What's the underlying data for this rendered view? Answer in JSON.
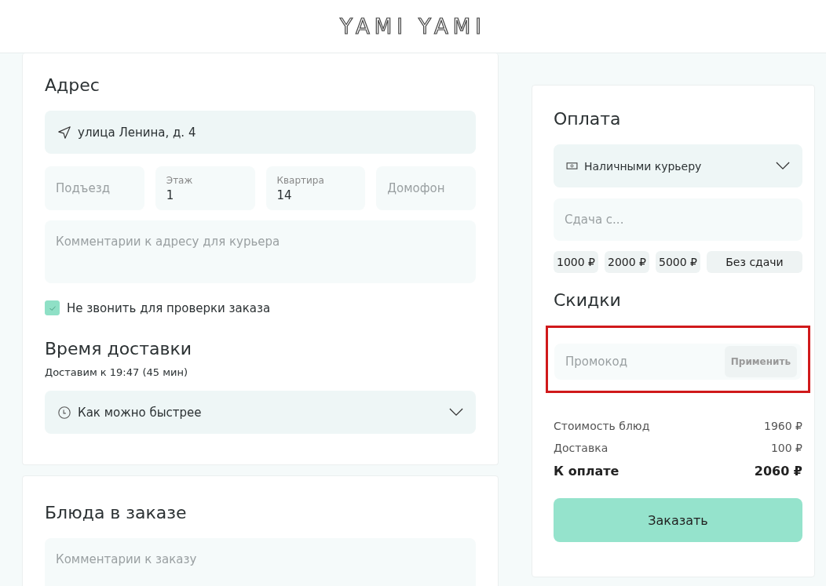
{
  "header": {
    "logo": "YAMI YAMI"
  },
  "address": {
    "title": "Адрес",
    "street": "улица Ленина, д. 4",
    "fields": [
      {
        "label": "Подъезд"
      },
      {
        "label": "Этаж",
        "value": "1"
      },
      {
        "label": "Квартира",
        "value": "14"
      },
      {
        "label": "Домофон"
      }
    ],
    "comment_placeholder": "Комментарии к адресу для курьера",
    "no_call": {
      "label": "Не звонить для проверки заказа",
      "checked": true
    }
  },
  "delivery": {
    "title": "Время доставки",
    "estimate": "Доставим к 19:47 (45 мин)",
    "time_select": "Как можно быстрее"
  },
  "dishes": {
    "title": "Блюда в заказе",
    "comment_placeholder": "Комментарии к заказу"
  },
  "payment": {
    "title": "Оплата",
    "method": "Наличными курьеру",
    "change_placeholder": "Сдача с...",
    "change_options": [
      {
        "label": "1000 ₽",
        "kind": "amount"
      },
      {
        "label": "2000 ₽",
        "kind": "amount"
      },
      {
        "label": "5000 ₽",
        "kind": "amount"
      },
      {
        "label": "Без сдачи",
        "kind": "none"
      }
    ]
  },
  "discounts": {
    "title": "Скидки",
    "promo_placeholder": "Промокод",
    "apply_button": "Применить",
    "highlighted": true
  },
  "totals": [
    {
      "label": "Стоимость блюд",
      "value": "1960 ₽",
      "kind": "line"
    },
    {
      "label": "Доставка",
      "value": "100 ₽",
      "kind": "line"
    },
    {
      "label": "К оплате",
      "value": "2060 ₽",
      "kind": "total"
    }
  ],
  "order_button": "Заказать"
}
